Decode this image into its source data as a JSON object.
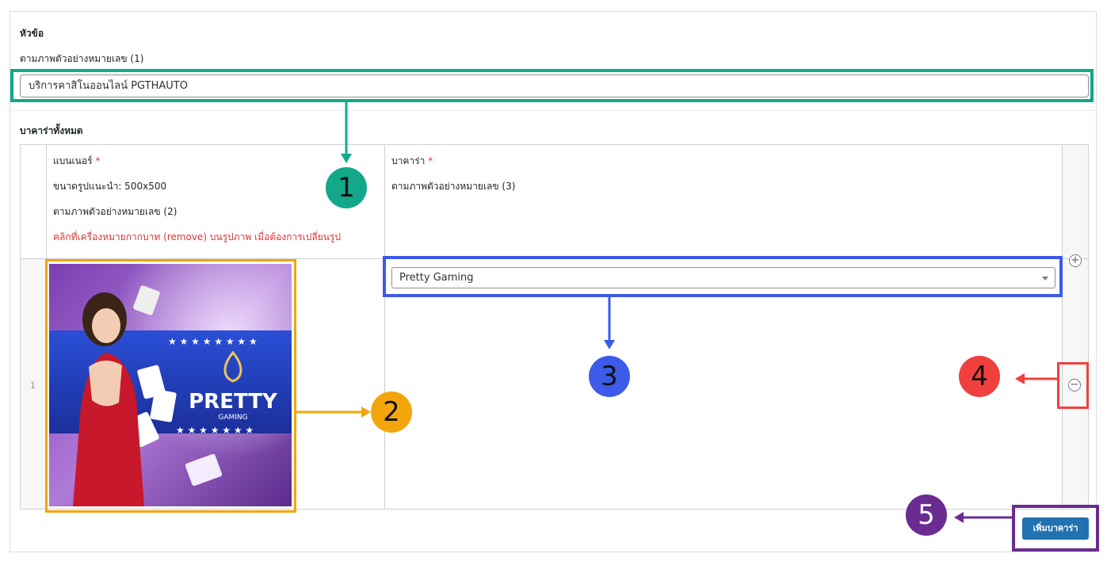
{
  "section_title": {
    "heading": "หัวข้อ",
    "hint": "ตามภาพตัวอย่างหมายเลข (1)",
    "value": "บริการคาสิโนออนไลน์ PGTHAUTO"
  },
  "repeater": {
    "heading": "บาคาร่าทั้งหมด",
    "banner_col": {
      "label": "แบนเนอร์",
      "required": "*",
      "size_hint": "ขนาดรูปแนะนำ: 500x500",
      "example_hint": "ตามภาพตัวอย่างหมายเลข (2)",
      "remove_hint": "คลิกที่เครื่องหมายกากบาท (remove) บนรูปภาพ เมื่อต้องการเปลี่ยนรูป"
    },
    "baccarat_col": {
      "label": "บาคาร่า",
      "required": "*",
      "example_hint": "ตามภาพตัวอย่างหมายเลข (3)"
    },
    "rows": [
      {
        "index": "1",
        "selected_value": "Pretty Gaming",
        "banner_brand": "PRETTY",
        "banner_sub": "GAMING"
      }
    ],
    "add_row_icon": "plus-circle-icon",
    "remove_row_icon": "minus-circle-icon",
    "add_button_label": "เพิ่มบาคาร่า"
  },
  "annotations": {
    "badges": [
      "1",
      "2",
      "3",
      "4",
      "5"
    ],
    "colors": {
      "one": "#13a88a",
      "two": "#f2a60c",
      "three": "#3d5be8",
      "four": "#f0403e",
      "five": "#6a2c91"
    }
  },
  "colors": {
    "primary_button": "#2271b1",
    "required": "#d63638",
    "border": "#ccd0d4"
  }
}
